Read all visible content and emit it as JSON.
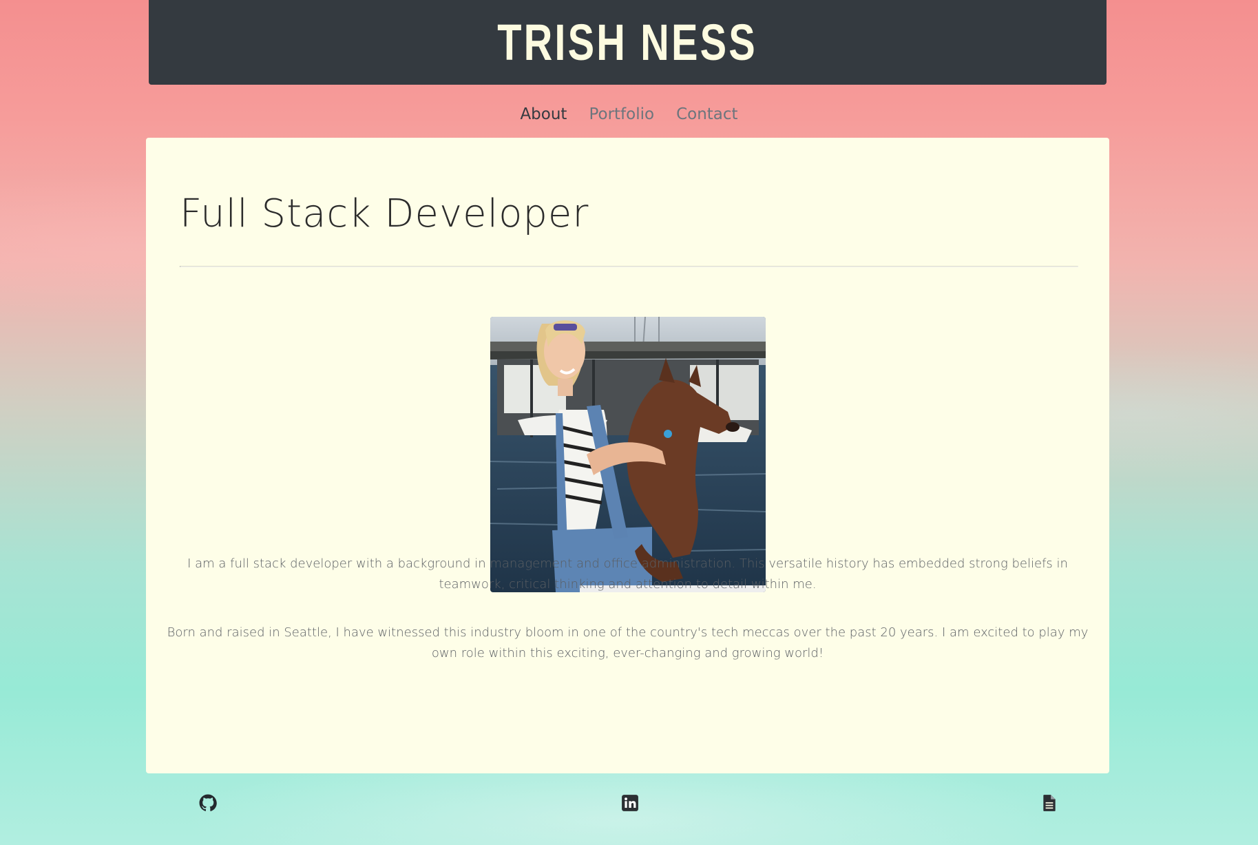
{
  "header": {
    "title": "TRISH NESS"
  },
  "nav": {
    "items": [
      {
        "label": "About",
        "active": true
      },
      {
        "label": "Portfolio",
        "active": false
      },
      {
        "label": "Contact",
        "active": false
      }
    ]
  },
  "main": {
    "heading": "Full Stack Developer",
    "paragraphs": [
      "I am a full stack developer with a background in management and office administration. This versatile history has embedded strong beliefs in teamwork, critical thinking and attention to detail within me.",
      "Born and raised in Seattle, I have witnessed this industry bloom in one of the country's tech meccas over the past 20 years. I am excited to play my own role within this exciting, ever-changing and growing world!"
    ]
  },
  "footer": {
    "icons": [
      "github-icon",
      "linkedin-icon",
      "resume-document-icon"
    ]
  },
  "colors": {
    "header_bg": "#343a40",
    "title": "#fdfbe0",
    "card_bg": "#fefee8",
    "nav_active": "#343a40",
    "nav_inactive": "#6c757d"
  }
}
